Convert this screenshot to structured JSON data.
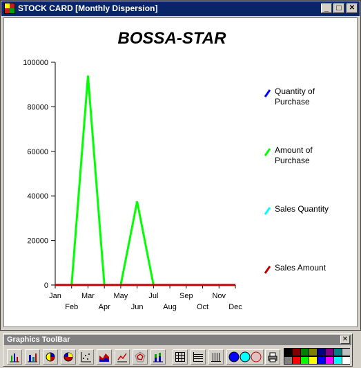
{
  "window": {
    "title": "STOCK CARD [Monthly Dispersion]",
    "controls": [
      "_",
      "□",
      "✕"
    ]
  },
  "chart_data": {
    "type": "line",
    "title": "BOSSA-STAR",
    "categories": [
      "Jan",
      "Feb",
      "Mar",
      "Apr",
      "May",
      "Jun",
      "Jul",
      "Aug",
      "Sep",
      "Oct",
      "Nov",
      "Dec"
    ],
    "ylim": [
      0,
      100000
    ],
    "yticks": [
      0,
      20000,
      40000,
      60000,
      80000,
      100000
    ],
    "ytick_labels": [
      "0",
      "20000",
      "40000",
      "60000",
      "80000",
      "100000"
    ],
    "grid": false,
    "legend_position": "right",
    "series": [
      {
        "name": "Quantity of Purchase",
        "color": "#0000ff",
        "values": [
          0,
          0,
          0,
          0,
          0,
          0,
          0,
          0,
          0,
          0,
          0,
          0
        ]
      },
      {
        "name": "Amount of Purchase",
        "color": "#00ff00",
        "values": [
          0,
          0,
          94000,
          0,
          0,
          37500,
          0,
          0,
          0,
          0,
          0,
          0
        ]
      },
      {
        "name": "Sales Quantity",
        "color": "#00ffff",
        "values": [
          0,
          0,
          0,
          0,
          0,
          0,
          0,
          0,
          0,
          0,
          0,
          0
        ]
      },
      {
        "name": "Sales Amount",
        "color": "#c00000",
        "values": [
          0,
          0,
          0,
          0,
          0,
          0,
          0,
          0,
          0,
          0,
          0,
          0
        ]
      }
    ]
  },
  "toolbar": {
    "title": "Graphics ToolBar",
    "close": "✕",
    "tools": [
      "bar-chart-icon",
      "bar-chart-3d-icon",
      "pie-chart-icon",
      "pie-chart-3d-icon",
      "scatter-chart-icon",
      "area-chart-icon",
      "line-chart-icon",
      "radar-chart-icon",
      "stacked-bar-icon",
      "grid-icon",
      "horizontal-lines-icon",
      "vertical-lines-icon",
      "color-circles-icon",
      "print-icon"
    ],
    "palette": [
      "#000000",
      "#800000",
      "#008000",
      "#808000",
      "#000080",
      "#800080",
      "#008080",
      "#c0c0c0",
      "#808080",
      "#ff0000",
      "#00ff00",
      "#ffff00",
      "#0000ff",
      "#ff00ff",
      "#00ffff",
      "#ffffff"
    ]
  }
}
